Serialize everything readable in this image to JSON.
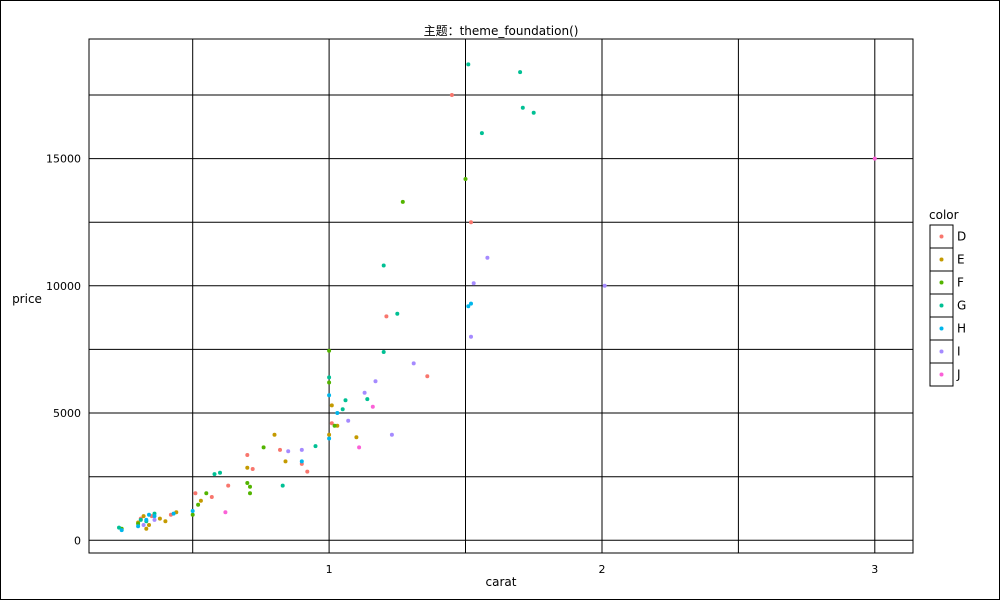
{
  "chart_data": {
    "type": "scatter",
    "title": "主题：theme_foundation()",
    "xlabel": "carat",
    "ylabel": "price",
    "xlim": [
      0.12,
      3.14
    ],
    "ylim": [
      -500,
      19700
    ],
    "x_ticks": [
      1,
      2,
      3
    ],
    "y_ticks": [
      0,
      5000,
      10000,
      15000
    ],
    "x_gridlines": [
      0.5,
      1,
      1.5,
      2,
      2.5,
      3
    ],
    "y_gridlines": [
      0,
      2500,
      5000,
      7500,
      10000,
      12500,
      15000,
      17500
    ],
    "grid": true,
    "legend": {
      "title": "color",
      "position": "right",
      "items": [
        "D",
        "E",
        "F",
        "G",
        "H",
        "I",
        "J"
      ],
      "colors": {
        "D": "#F8766D",
        "E": "#C49A00",
        "F": "#53B400",
        "G": "#00C094",
        "H": "#00B6EB",
        "I": "#A58AFF",
        "J": "#FB61D7"
      }
    },
    "series": [
      {
        "name": "D",
        "points": [
          [
            0.31,
            850
          ],
          [
            0.35,
            950
          ],
          [
            0.42,
            1000
          ],
          [
            0.51,
            1850
          ],
          [
            0.57,
            1700
          ],
          [
            0.7,
            3350
          ],
          [
            0.72,
            2800
          ],
          [
            0.9,
            3000
          ],
          [
            0.92,
            2700
          ],
          [
            1.01,
            4600
          ],
          [
            1.21,
            8800
          ],
          [
            1.36,
            6450
          ],
          [
            1.45,
            17500
          ],
          [
            1.52,
            12500
          ],
          [
            0.63,
            2150
          ],
          [
            0.82,
            3550
          ]
        ]
      },
      {
        "name": "E",
        "points": [
          [
            0.3,
            700
          ],
          [
            0.32,
            950
          ],
          [
            0.33,
            450
          ],
          [
            0.34,
            600
          ],
          [
            0.38,
            850
          ],
          [
            0.4,
            750
          ],
          [
            0.53,
            1550
          ],
          [
            0.7,
            2850
          ],
          [
            0.8,
            4150
          ],
          [
            0.84,
            3100
          ],
          [
            1.01,
            5300
          ],
          [
            1.03,
            4500
          ],
          [
            1.1,
            4050
          ],
          [
            1.0,
            4150
          ],
          [
            0.44,
            1100
          ]
        ]
      },
      {
        "name": "F",
        "points": [
          [
            0.24,
            450
          ],
          [
            0.3,
            650
          ],
          [
            0.5,
            1000
          ],
          [
            0.55,
            1850
          ],
          [
            0.7,
            2250
          ],
          [
            0.71,
            1850
          ],
          [
            0.71,
            2100
          ],
          [
            0.76,
            3650
          ],
          [
            1.0,
            6200
          ],
          [
            1.0,
            7450
          ],
          [
            1.27,
            13300
          ],
          [
            1.5,
            14200
          ],
          [
            1.02,
            4500
          ],
          [
            0.52,
            1400
          ]
        ]
      },
      {
        "name": "G",
        "points": [
          [
            0.23,
            500
          ],
          [
            0.31,
            800
          ],
          [
            0.33,
            750
          ],
          [
            0.36,
            1050
          ],
          [
            0.58,
            2600
          ],
          [
            0.6,
            2650
          ],
          [
            0.83,
            2150
          ],
          [
            0.95,
            3700
          ],
          [
            1.0,
            6400
          ],
          [
            1.05,
            5150
          ],
          [
            1.14,
            5550
          ],
          [
            1.2,
            10800
          ],
          [
            1.2,
            7400
          ],
          [
            1.25,
            8900
          ],
          [
            1.51,
            18700
          ],
          [
            1.56,
            16000
          ],
          [
            1.7,
            18400
          ],
          [
            1.71,
            17000
          ],
          [
            1.75,
            16800
          ],
          [
            1.06,
            5500
          ]
        ]
      },
      {
        "name": "H",
        "points": [
          [
            0.24,
            400
          ],
          [
            0.3,
            550
          ],
          [
            0.33,
            800
          ],
          [
            0.36,
            950
          ],
          [
            0.43,
            1050
          ],
          [
            0.5,
            1150
          ],
          [
            0.9,
            3100
          ],
          [
            1.0,
            4000
          ],
          [
            1.0,
            5700
          ],
          [
            1.03,
            5000
          ],
          [
            1.51,
            9200
          ],
          [
            1.52,
            9300
          ],
          [
            0.34,
            1000
          ]
        ]
      },
      {
        "name": "I",
        "points": [
          [
            0.32,
            600
          ],
          [
            0.36,
            800
          ],
          [
            0.85,
            3500
          ],
          [
            0.9,
            3550
          ],
          [
            1.07,
            4700
          ],
          [
            1.13,
            5800
          ],
          [
            1.17,
            6250
          ],
          [
            1.23,
            4150
          ],
          [
            1.31,
            6950
          ],
          [
            1.52,
            8000
          ],
          [
            1.53,
            10100
          ],
          [
            1.58,
            11100
          ],
          [
            2.01,
            10000
          ]
        ]
      },
      {
        "name": "J",
        "points": [
          [
            0.62,
            1100
          ],
          [
            1.11,
            3650
          ],
          [
            1.16,
            5250
          ],
          [
            3.0,
            15000
          ]
        ]
      }
    ]
  }
}
